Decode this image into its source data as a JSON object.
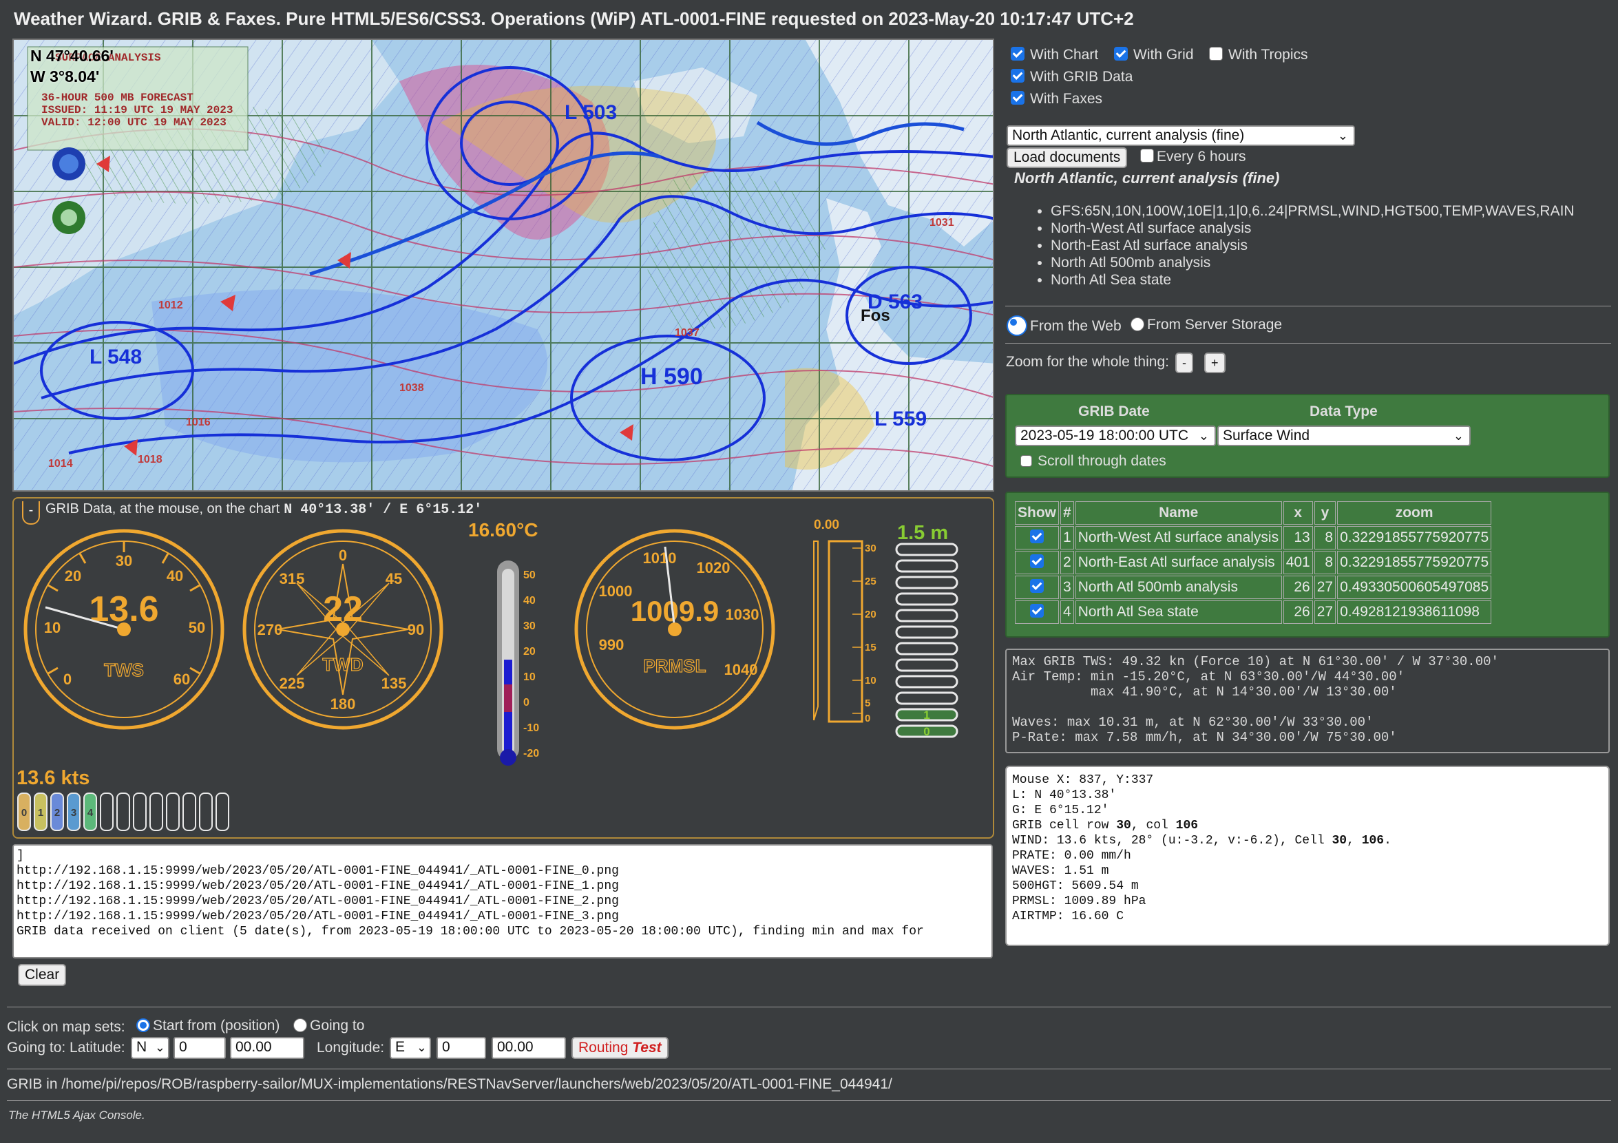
{
  "title": "Weather Wizard. GRIB & Faxes. Pure HTML5/ES6/CSS3. Operations (WiP) ATL-0001-FINE requested on 2023-May-20 10:17:47 UTC+2",
  "map": {
    "position_lat": "N 47°40.66'",
    "position_lng": "W 3°8.04'",
    "fax_text": [
      "SURFACE ANALYSIS",
      "36-HOUR 500 MB FORECAST",
      "ISSUED: 11:19 UTC 19 MAY 2023",
      "VALID: 12:00 UTC 19 MAY 2023"
    ],
    "pressure_labels": [
      "L 503",
      "L 548",
      "H 590",
      "L 559",
      "D 563",
      "1037",
      "1038",
      "1031",
      "1012",
      "1016",
      "1018",
      "1014"
    ],
    "place_label": "Fos"
  },
  "grib_panel": {
    "collapse_label": "-",
    "header_text": "GRIB Data, at the mouse, on the chart",
    "header_pos": "N 40°13.38' / E 6°15.12'",
    "tws": {
      "value": "13.6",
      "label": "TWS",
      "ticks": [
        "0",
        "10",
        "20",
        "30",
        "40",
        "50",
        "60"
      ]
    },
    "twd": {
      "value": "22",
      "label": "TWD",
      "ticks": [
        "0",
        "45",
        "90",
        "135",
        "180",
        "225",
        "270",
        "315"
      ]
    },
    "temp": {
      "readout": "16.60°C",
      "ticks": [
        "50",
        "40",
        "30",
        "20",
        "10",
        "0",
        "-10",
        "-20"
      ],
      "value_c": 16.6
    },
    "prmsl": {
      "value": "1009.9",
      "label": "PRMSL",
      "ticks": [
        "990",
        "1000",
        "1010",
        "1020",
        "1030",
        "1040"
      ]
    },
    "rain": {
      "readout": "0.00",
      "ticks": [
        "30",
        "25",
        "20",
        "15",
        "10",
        "5",
        "0"
      ]
    },
    "waves": {
      "readout": "1.5 m",
      "marks": [
        "1",
        "0"
      ]
    },
    "beaufort": {
      "readout": "13.6 kts",
      "digits": [
        "0",
        "1",
        "2",
        "3",
        "4"
      ]
    }
  },
  "console": {
    "lines": [
      "]",
      "http://192.168.1.15:9999/web/2023/05/20/ATL-0001-FINE_044941/_ATL-0001-FINE_0.png",
      "http://192.168.1.15:9999/web/2023/05/20/ATL-0001-FINE_044941/_ATL-0001-FINE_1.png",
      "http://192.168.1.15:9999/web/2023/05/20/ATL-0001-FINE_044941/_ATL-0001-FINE_2.png",
      "http://192.168.1.15:9999/web/2023/05/20/ATL-0001-FINE_044941/_ATL-0001-FINE_3.png",
      "GRIB data received on client (5 date(s), from 2023-05-19 18:00:00 UTC to 2023-05-20 18:00:00 UTC), finding min and max for"
    ],
    "clear_label": "Clear"
  },
  "options": {
    "with_chart": "With Chart",
    "with_grid": "With Grid",
    "with_tropics": "With Tropics",
    "with_grib": "With GRIB Data",
    "with_faxes": "With Faxes"
  },
  "documents": {
    "selected": "North Atlantic, current analysis (fine)",
    "load_label": "Load documents",
    "every6_label": "Every 6 hours",
    "title": "North Atlantic, current analysis (fine)",
    "items": [
      "GFS:65N,10N,100W,10E|1,1|0,6..24|PRMSL,WIND,HGT500,TEMP,WAVES,RAIN",
      "North-West Atl surface analysis",
      "North-East Atl surface analysis",
      "North Atl 500mb analysis",
      "North Atl Sea state"
    ]
  },
  "source": {
    "web": "From the Web",
    "server": "From Server Storage"
  },
  "zoom": {
    "label": "Zoom for the whole thing:",
    "minus": "-",
    "plus": "+"
  },
  "grib": {
    "date_header": "GRIB Date",
    "type_header": "Data Type",
    "date_value": "2023-05-19 18:00:00 UTC",
    "type_value": "Surface Wind",
    "scroll_label": "Scroll through dates"
  },
  "doc_table": {
    "headers": [
      "Show",
      "#",
      "Name",
      "x",
      "y",
      "zoom"
    ],
    "rows": [
      {
        "num": "1",
        "name": "North-West Atl surface analysis",
        "x": "13",
        "y": "8",
        "zoom": "0.32291855775920775"
      },
      {
        "num": "2",
        "name": "North-East Atl surface analysis",
        "x": "401",
        "y": "8",
        "zoom": "0.32291855775920775"
      },
      {
        "num": "3",
        "name": "North Atl 500mb analysis",
        "x": "26",
        "y": "27",
        "zoom": "0.49330500605497085"
      },
      {
        "num": "4",
        "name": "North Atl Sea state",
        "x": "26",
        "y": "27",
        "zoom": "0.4928121938611098"
      }
    ]
  },
  "stats": [
    "Max GRIB TWS: 49.32 kn (Force 10) at N 61°30.00' / W 37°30.00'",
    "Air Temp: min -15.20°C, at N 63°30.00'/W 44°30.00'",
    "          max 41.90°C, at N 14°30.00'/W 13°30.00'",
    "",
    "Waves: max 10.31 m, at N 62°30.00'/W 33°30.00'",
    "P-Rate: max 7.58 mm/h, at N 34°30.00'/W 75°30.00'"
  ],
  "mouse_info": [
    {
      "t": "Mouse X: 837, Y:337"
    },
    {
      "t": "L: N 40°13.38'"
    },
    {
      "t": "G: E 6°15.12'"
    },
    {
      "t": "GRIB cell row ",
      "b1": "30",
      "t2": ", col ",
      "b2": "106"
    },
    {
      "t": "WIND: 13.6 kts, 28° (u:-3.2, v:-6.2), Cell ",
      "b1": "30",
      "t2": ", ",
      "b2": "106",
      "t3": "."
    },
    {
      "t": "PRATE: 0.00 mm/h"
    },
    {
      "t": "WAVES: 1.51 m"
    },
    {
      "t": "500HGT: 5609.54 m"
    },
    {
      "t": "PRMSL: 1009.89 hPa"
    },
    {
      "t": "AIRTMP: 16.60 C"
    }
  ],
  "routing": {
    "click_label": "Click on map sets:",
    "start_label": "Start from (position)",
    "going_label": "Going to",
    "goingto_lat_label": "Going to: Latitude:",
    "lat_hemi": "N",
    "lat_deg": "0",
    "lat_min": "00.00",
    "lng_label": "Longitude:",
    "lng_hemi": "E",
    "lng_deg": "0",
    "lng_min": "00.00",
    "btn_label": "Routing",
    "btn_test": "Test"
  },
  "grib_path": "GRIB in /home/pi/repos/ROB/raspberry-sailor/MUX-implementations/RESTNavServer/launchers/web/2023/05/20/ATL-0001-FINE_044941/",
  "footer": "The HTML5 Ajax Console.",
  "colors": {
    "accent_orange": "#f0a830",
    "panel_green": "#3f7a3f",
    "background": "#3a3d3f",
    "checkbox_blue": "#1a73e8"
  }
}
